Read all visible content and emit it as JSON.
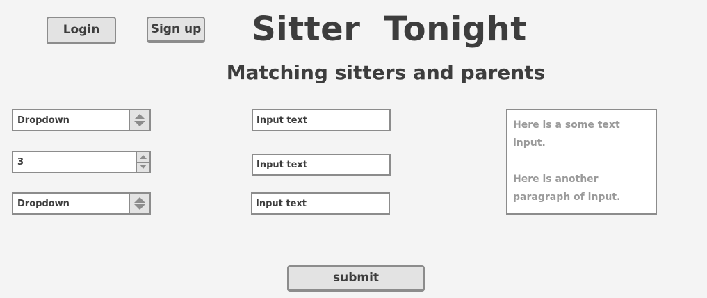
{
  "header": {
    "login_label": "Login",
    "signup_label": "Sign up",
    "title": "Sitter  Tonight",
    "subtitle": "Matching sitters and parents"
  },
  "form": {
    "dropdown_1": {
      "value": "Dropdown"
    },
    "stepper": {
      "value": "3"
    },
    "dropdown_2": {
      "value": "Dropdown"
    },
    "text_inputs": [
      {
        "value": "Input text"
      },
      {
        "value": "Input text"
      },
      {
        "value": "Input text"
      }
    ],
    "textarea": {
      "paragraphs": [
        "Here is a some text input.",
        "Here is another paragraph of input."
      ]
    },
    "submit_label": "submit"
  },
  "icons": {
    "dropdown_arrows": "up-down-triangle-icon",
    "stepper_arrows": "stepper-up-down-icon"
  },
  "colors": {
    "background": "#f4f4f4",
    "border": "#8c8c8c",
    "button_fill": "#e3e3e3",
    "text": "#3d3d3d",
    "placeholder_text": "#9a9a9a"
  }
}
